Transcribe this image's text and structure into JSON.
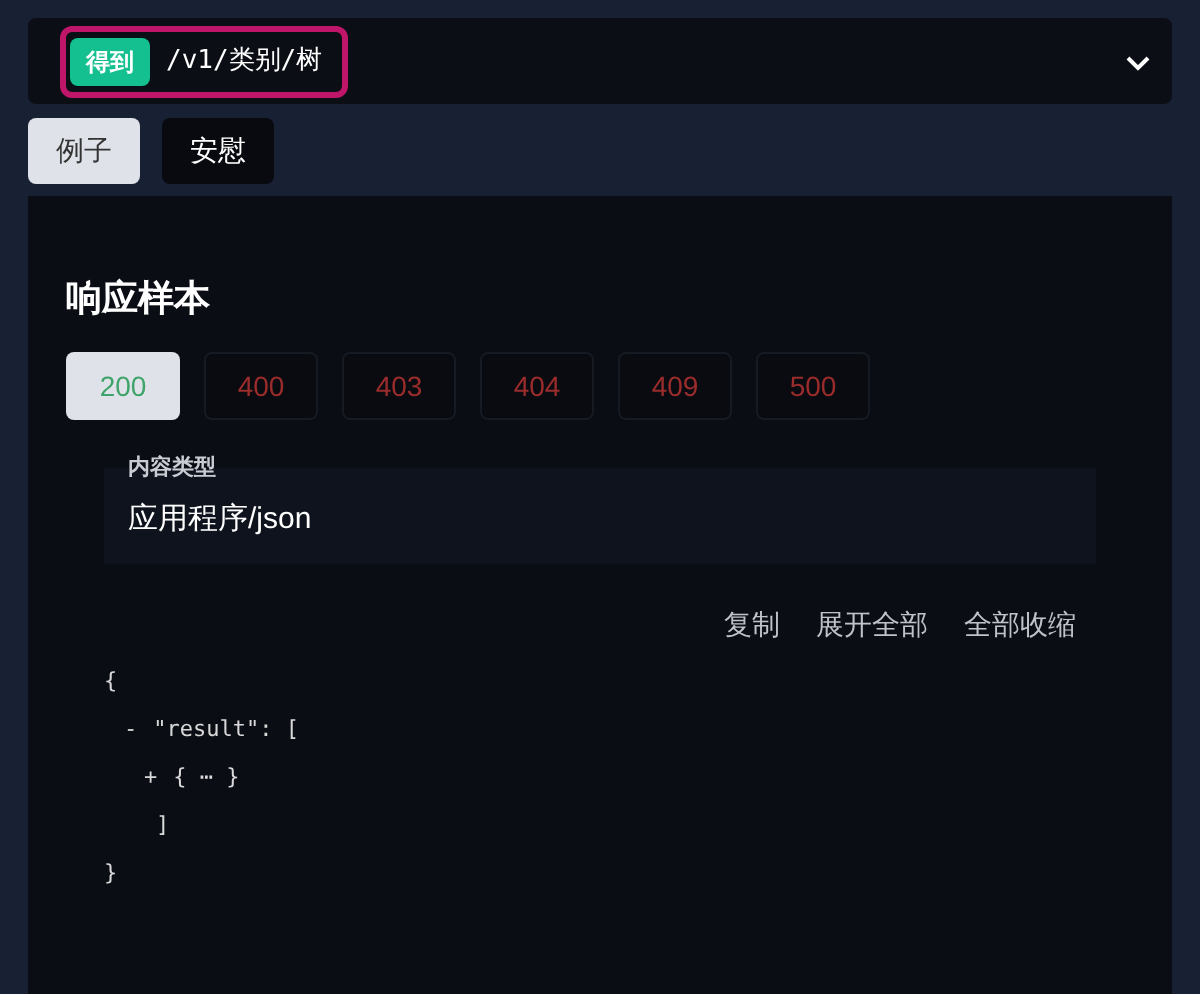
{
  "endpoint": {
    "method": "得到",
    "path": "/v1/类别/树",
    "expanded": true
  },
  "tabs": [
    {
      "label": "例子",
      "selected": true
    },
    {
      "label": "安慰",
      "selected": false
    }
  ],
  "response": {
    "title": "响应样本",
    "status_codes": [
      {
        "label": "200",
        "selected": true,
        "color": "#3fa46a"
      },
      {
        "label": "400",
        "selected": false,
        "color": "#9b2c2c"
      },
      {
        "label": "403",
        "selected": false,
        "color": "#9b2c2c"
      },
      {
        "label": "404",
        "selected": false,
        "color": "#9b2c2c"
      },
      {
        "label": "409",
        "selected": false,
        "color": "#9b2c2c"
      },
      {
        "label": "500",
        "selected": false,
        "color": "#9b2c2c"
      }
    ],
    "content_type": {
      "label": "内容类型",
      "value": "应用程序/json"
    },
    "actions": [
      "复制",
      "展开全部",
      "全部收缩"
    ],
    "json_tree": {
      "open": "{",
      "close": "}",
      "children": [
        {
          "toggle": "-",
          "open": "\"result\": [",
          "close": "]",
          "children": [
            {
              "toggle": "+",
              "open": "{ ⋯ }"
            }
          ]
        }
      ]
    }
  }
}
